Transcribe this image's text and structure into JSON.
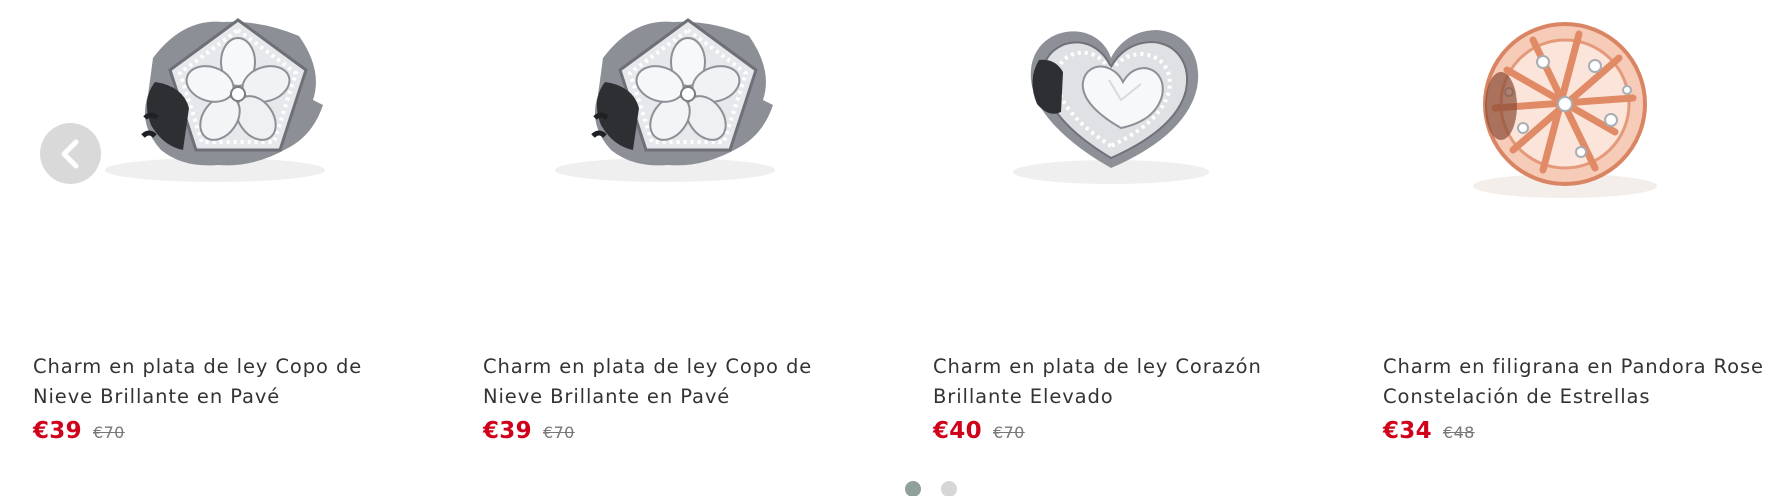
{
  "carousel": {
    "prev_button_label": "Anterior",
    "products": [
      {
        "image_icon": "snowflake-pave-charm-icon",
        "title": "Charm en plata de ley Copo de Nieve Brillante en Pavé",
        "price": "€39",
        "old_price": "€70"
      },
      {
        "image_icon": "snowflake-pave-charm-icon",
        "title": "Charm en plata de ley Copo de Nieve Brillante en Pavé",
        "price": "€39",
        "old_price": "€70"
      },
      {
        "image_icon": "heart-pave-charm-icon",
        "title": "Charm en plata de ley Corazón Brillante Elevado",
        "price": "€40",
        "old_price": "€70"
      },
      {
        "image_icon": "rose-constellation-charm-icon",
        "title": "Charm en filigrana en Pandora Rose Constelación de Estrellas",
        "price": "€34",
        "old_price": "€48"
      }
    ],
    "pagination": {
      "total_pages": 2,
      "active_page": 1
    }
  },
  "colors": {
    "sale_price": "#d0021b",
    "old_price": "#777777",
    "title_text": "#333333",
    "nav_button_bg": "#d9d9d9",
    "dot_active": "#8fa09d",
    "dot_inactive": "#d6d6d6",
    "silver": "#c8cbd0",
    "rose_gold": "#f0a88a"
  }
}
